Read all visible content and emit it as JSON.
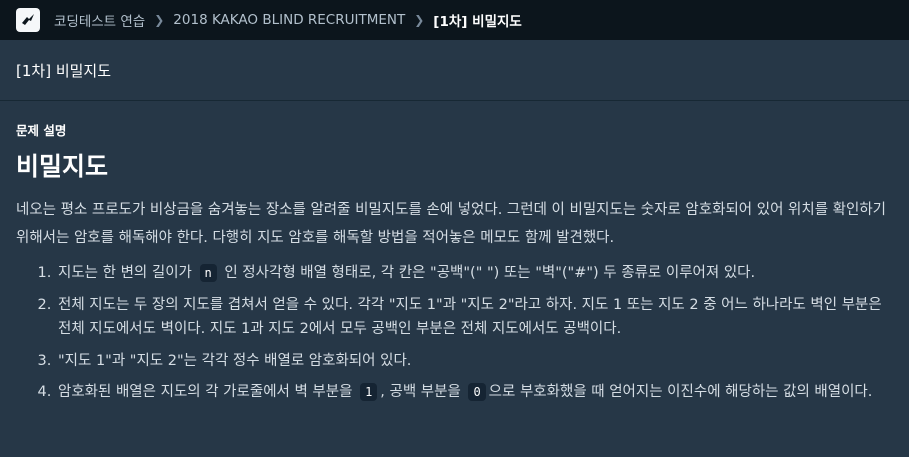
{
  "breadcrumb": {
    "items": [
      "코딩테스트 연습",
      "2018 KAKAO BLIND RECRUITMENT"
    ],
    "current": "[1차] 비밀지도"
  },
  "problem_title": "[1차] 비밀지도",
  "section_label": "문제 설명",
  "heading": "비밀지도",
  "intro": "네오는 평소 프로도가 비상금을 숨겨놓는 장소를 알려줄 비밀지도를 손에 넣었다. 그런데 이 비밀지도는 숫자로 암호화되어 있어 위치를 확인하기 위해서는 암호를 해독해야 한다. 다행히 지도 암호를 해독할 방법을 적어놓은 메모도 함께 발견했다.",
  "rules": {
    "r1_a": "지도는 한 변의 길이가",
    "r1_code": "n",
    "r1_b": "인 정사각형 배열 형태로, 각 칸은 \"공백\"(\" \") 또는 \"벽\"(\"#\") 두 종류로 이루어져 있다.",
    "r2": "전체 지도는 두 장의 지도를 겹쳐서 얻을 수 있다. 각각 \"지도 1\"과 \"지도 2\"라고 하자. 지도 1 또는 지도 2 중 어느 하나라도 벽인 부분은 전체 지도에서도 벽이다. 지도 1과 지도 2에서 모두 공백인 부분은 전체 지도에서도 공백이다.",
    "r3": "\"지도 1\"과 \"지도 2\"는 각각 정수 배열로 암호화되어 있다.",
    "r4_a": "암호화된 배열은 지도의 각 가로줄에서 벽 부분을",
    "r4_code1": "1",
    "r4_b": ", 공백 부분을",
    "r4_code2": "0",
    "r4_c": "으로 부호화했을 때 얻어지는 이진수에 해당하는 값의 배열이다."
  },
  "icons": {
    "logo": "programmers-logo-icon",
    "separator": "chevron-right-icon"
  }
}
